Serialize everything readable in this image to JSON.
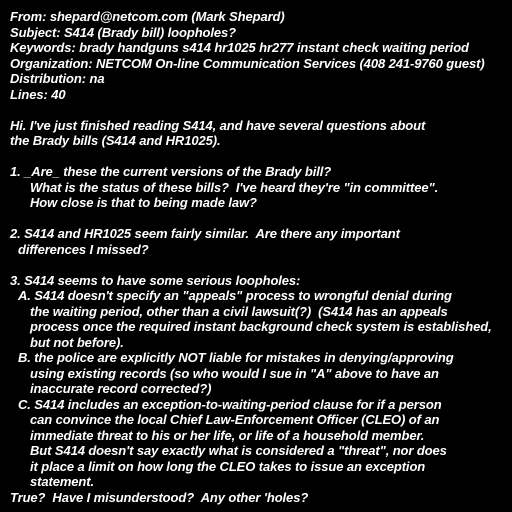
{
  "header": {
    "from": "From: shepard@netcom.com (Mark Shepard)",
    "subject": "Subject: S414 (Brady bill) loopholes?",
    "keywords": "Keywords: brady handguns s414 hr1025 hr277 instant check waiting period",
    "organization": "Organization: NETCOM On-line Communication Services (408 241-9760 guest)",
    "distribution": "Distribution: na",
    "lines": "Lines: 40"
  },
  "body": {
    "intro": [
      "Hi. I've just finished reading S414, and have several questions about",
      "the Brady bills (S414 and HR1025)."
    ],
    "q1": [
      "1. _Are_ these the current versions of the Brady bill?",
      "What is the status of these bills?  I've heard they're \"in committee\".",
      "How close is that to being made law?"
    ],
    "q2": [
      "2. S414 and HR1025 seem fairly similar.  Are there any important",
      "differences I missed?"
    ],
    "q3": "3. S414 seems to have some serious loopholes:",
    "a": [
      "A. S414 doesn't specify an \"appeals\" process to wrongful denial during",
      "the waiting period, other than a civil lawsuit(?)  (S414 has an appeals",
      "process once the required instant background check system is established,",
      "but not before)."
    ],
    "b": [
      "B. the police are explicitly NOT liable for mistakes in denying/approving",
      "using existing records (so who would I sue in \"A\" above to have an",
      "inaccurate record corrected?)"
    ],
    "c": [
      "C. S414 includes an exception-to-waiting-period clause for if a person",
      "can convince the local Chief Law-Enforcement Officer (CLEO) of an",
      "immediate threat to his or her life, or life of a household member.",
      "But S414 doesn't say exactly what is considered a \"threat\", nor does",
      "it place a limit on how long the CLEO takes to issue an exception",
      "statement."
    ],
    "closing": "True?  Have I misunderstood?  Any other 'holes?"
  }
}
